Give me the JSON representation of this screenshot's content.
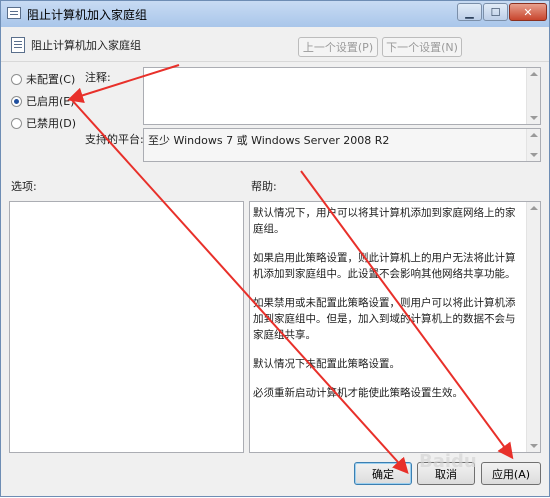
{
  "window": {
    "title": "阻止计算机加入家庭组"
  },
  "header": {
    "title": "阻止计算机加入家庭组",
    "prev_label": "上一个设置(P)",
    "next_label": "下一个设置(N)"
  },
  "options": {
    "not_configured": "未配置(C)",
    "enabled": "已启用(E)",
    "disabled": "已禁用(D)",
    "selected": "enabled"
  },
  "comment": {
    "label": "注释:",
    "value": ""
  },
  "platform": {
    "label": "支持的平台:",
    "value": "至少 Windows 7 或 Windows Server 2008 R2"
  },
  "sections": {
    "options_label": "选项:",
    "help_label": "帮助:"
  },
  "help": {
    "paragraphs": [
      "默认情况下，用户可以将其计算机添加到家庭网络上的家庭组。",
      "如果启用此策略设置，则此计算机上的用户无法将此计算机添加到家庭组中。此设置不会影响其他网络共享功能。",
      "如果禁用或未配置此策略设置，则用户可以将此计算机添加到家庭组中。但是，加入到域的计算机上的数据不会与家庭组共享。",
      "默认情况下未配置此策略设置。",
      "必须重新启动计算机才能使此策略设置生效。"
    ]
  },
  "buttons": {
    "ok": "确定",
    "cancel": "取消",
    "apply": "应用(A)"
  },
  "watermark": "Baidu",
  "colors": {
    "annotation": "#e8302a",
    "accent": "#1f4f9f"
  }
}
